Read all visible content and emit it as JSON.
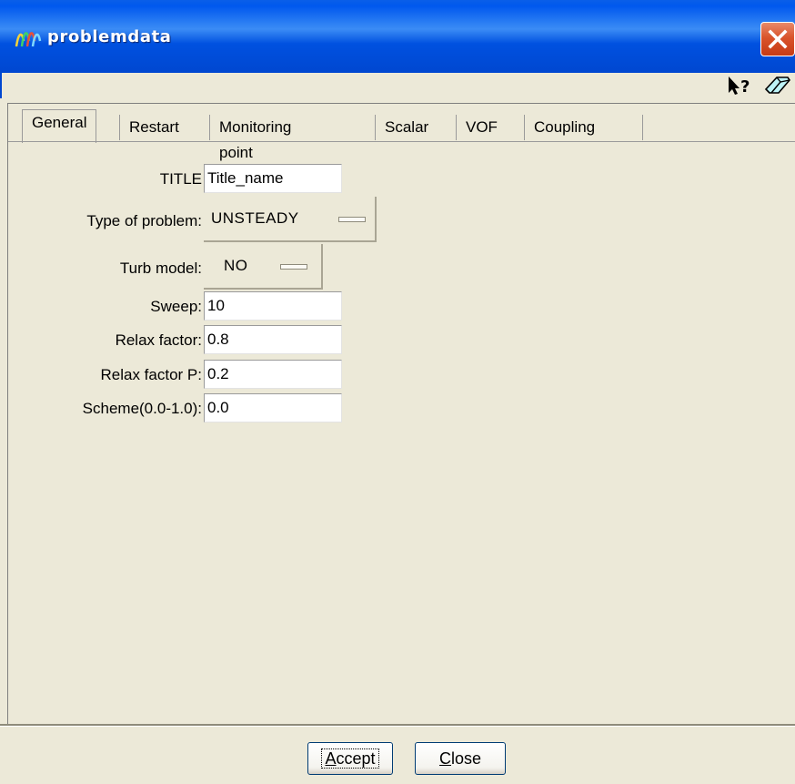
{
  "window": {
    "title": "problemdata",
    "colors": {
      "titlebar": "#0058ee",
      "background": "#ece9d8",
      "close": "#d9542c"
    },
    "icons": [
      "app-icon",
      "close-icon",
      "context-help-icon",
      "eraser-icon"
    ]
  },
  "tabs": [
    {
      "label": "General",
      "active": true
    },
    {
      "label": "Restart"
    },
    {
      "label": "Monitoring point"
    },
    {
      "label": "Scalar"
    },
    {
      "label": "VOF"
    },
    {
      "label": "Coupling"
    }
  ],
  "form": {
    "title_label": "TITLE",
    "title_value": "Title_name",
    "problem_type_label": "Type of problem:",
    "problem_type_value": "UNSTEADY",
    "turb_model_label": "Turb model:",
    "turb_model_value": "NO",
    "sweep_label": "Sweep:",
    "sweep_value": "10",
    "relax_label": "Relax factor:",
    "relax_value": "0.8",
    "relax_p_label": "Relax factor P:",
    "relax_p_value": "0.2",
    "scheme_label": "Scheme(0.0-1.0):",
    "scheme_value": "0.0"
  },
  "buttons": {
    "accept_prefix": "A",
    "accept_rest": "ccept",
    "close_prefix": "C",
    "close_rest": "lose"
  }
}
